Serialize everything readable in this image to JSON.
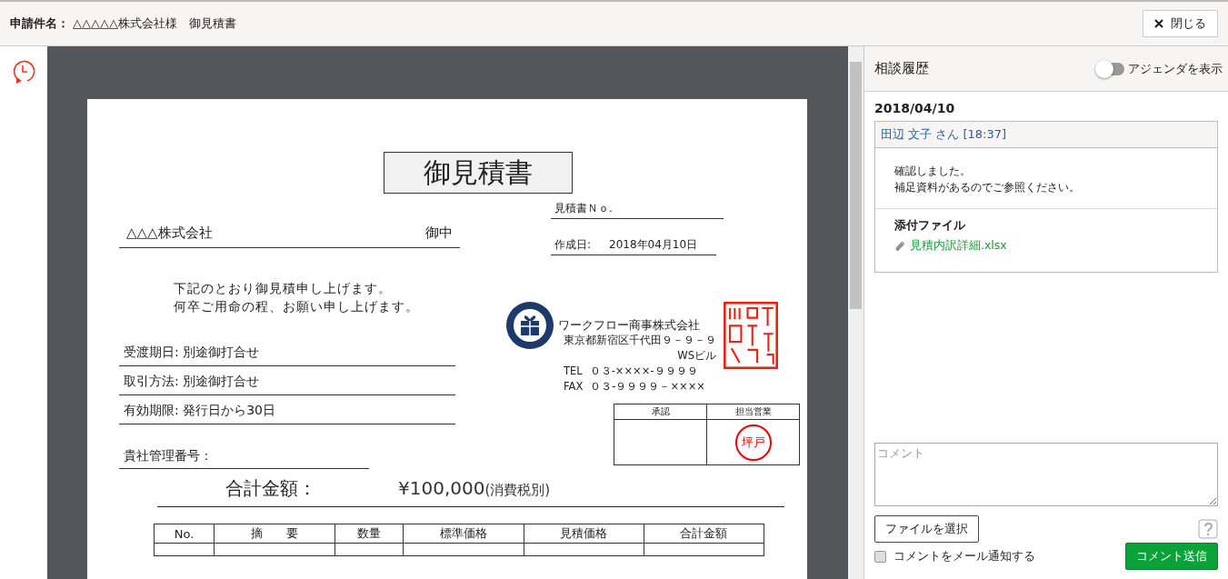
{
  "header": {
    "label": "申請件名：",
    "subject": "△△△△△株式会社様　御見積書",
    "close_button": "閉じる"
  },
  "document": {
    "title": "御見積書",
    "recipient": "△△△株式会社",
    "honorific": "御中",
    "estimate_no_label": "見積書Ｎｏ.",
    "created_label": "作成日:",
    "created_date": "2018年04月10日",
    "greeting": [
      "下記のとおり御見積申し上げます。",
      "何卒ご用命の程、お願い申し上げます。"
    ],
    "terms": [
      {
        "label": "受渡期日:",
        "value": "別途御打合せ"
      },
      {
        "label": "取引方法:",
        "value": "別途御打合せ"
      },
      {
        "label": "有効期限:",
        "value": "発行日から30日"
      }
    ],
    "client_no_label": "貴社管理番号：",
    "company": {
      "name": "ワークフロー商事株式会社",
      "address": "東京都新宿区千代田９－９－９",
      "building": "WSビル",
      "tel_label": "TEL",
      "tel": "０３-××××-９９９９",
      "fax_label": "FAX",
      "fax": "０３-９９９９－××××"
    },
    "approval": {
      "columns": [
        "承認",
        "担当営業"
      ],
      "stamp": "坪戸"
    },
    "total_label": "合計金額：",
    "total_amount": "¥100,000",
    "tax_note": "(消費税別)",
    "table_columns": [
      "No.",
      "摘　　要",
      "数量",
      "標準価格",
      "見積価格",
      "合計金額"
    ]
  },
  "history": {
    "title": "相談履歴",
    "agenda_toggle": {
      "label": "アジェンダを表示",
      "on": false
    },
    "date": "2018/04/10",
    "entries": [
      {
        "author": "田辺 文子",
        "honorific": "さん",
        "time": "[18:37]",
        "message": [
          "確認しました。",
          "補足資料があるのでご参照ください。"
        ],
        "attachments_label": "添付ファイル",
        "attachments": [
          "見積内訳詳細.xlsx"
        ]
      }
    ]
  },
  "composer": {
    "placeholder": "コメント",
    "file_button": "ファイルを選択",
    "notify": {
      "label": "コメントをメール通知する",
      "checked": false
    },
    "send_button": "コメント送信"
  }
}
